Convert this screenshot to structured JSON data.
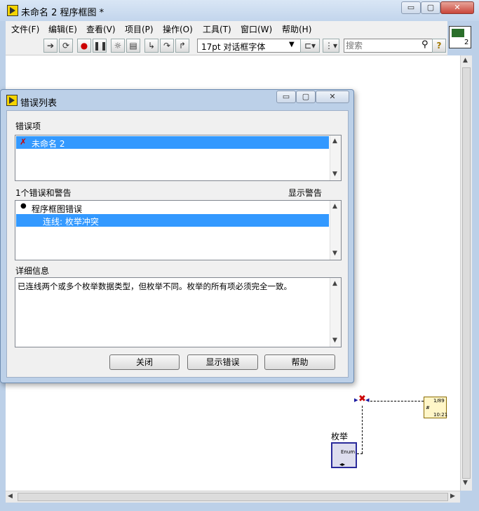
{
  "window": {
    "title": "未命名 2 程序框图 *",
    "controls": {
      "minimize": "▭",
      "maximize": "▢",
      "close": "✕"
    }
  },
  "menu": {
    "items": [
      "文件(F)",
      "编辑(E)",
      "查看(V)",
      "项目(P)",
      "操作(O)",
      "工具(T)",
      "窗口(W)",
      "帮助(H)"
    ]
  },
  "toolbar": {
    "font_value": "17pt 对话框字体",
    "search_placeholder": "搜索",
    "help_glyph": "?"
  },
  "vi_icon": {
    "label": "2"
  },
  "dialog": {
    "title": "错误列表",
    "error_items_label": "错误项",
    "error_items": [
      {
        "text": "未命名 2",
        "selected": true
      }
    ],
    "count_label": "1个错误和警告",
    "show_warnings_label": "显示警告",
    "show_warnings_checked": false,
    "errors": [
      {
        "text": "程序框图错误",
        "level": 0,
        "selected": false
      },
      {
        "text": "连线: 枚举冲突",
        "level": 1,
        "selected": true
      }
    ],
    "details_label": "详细信息",
    "details_text": "已连线两个或多个枚举数据类型，但枚举不同。枚举的所有项必须完全一致。",
    "buttons": {
      "close": "关闭",
      "show_error": "显示错误",
      "help": "帮助"
    }
  },
  "diagram": {
    "enum_label": "枚举",
    "enum_text": "Enum",
    "indicator_lines": [
      "1/89",
      "#",
      "10:21"
    ]
  },
  "colors": {
    "selection": "#3399ff",
    "frame": "#bcd0e8",
    "error_mark": "#cc0000"
  }
}
